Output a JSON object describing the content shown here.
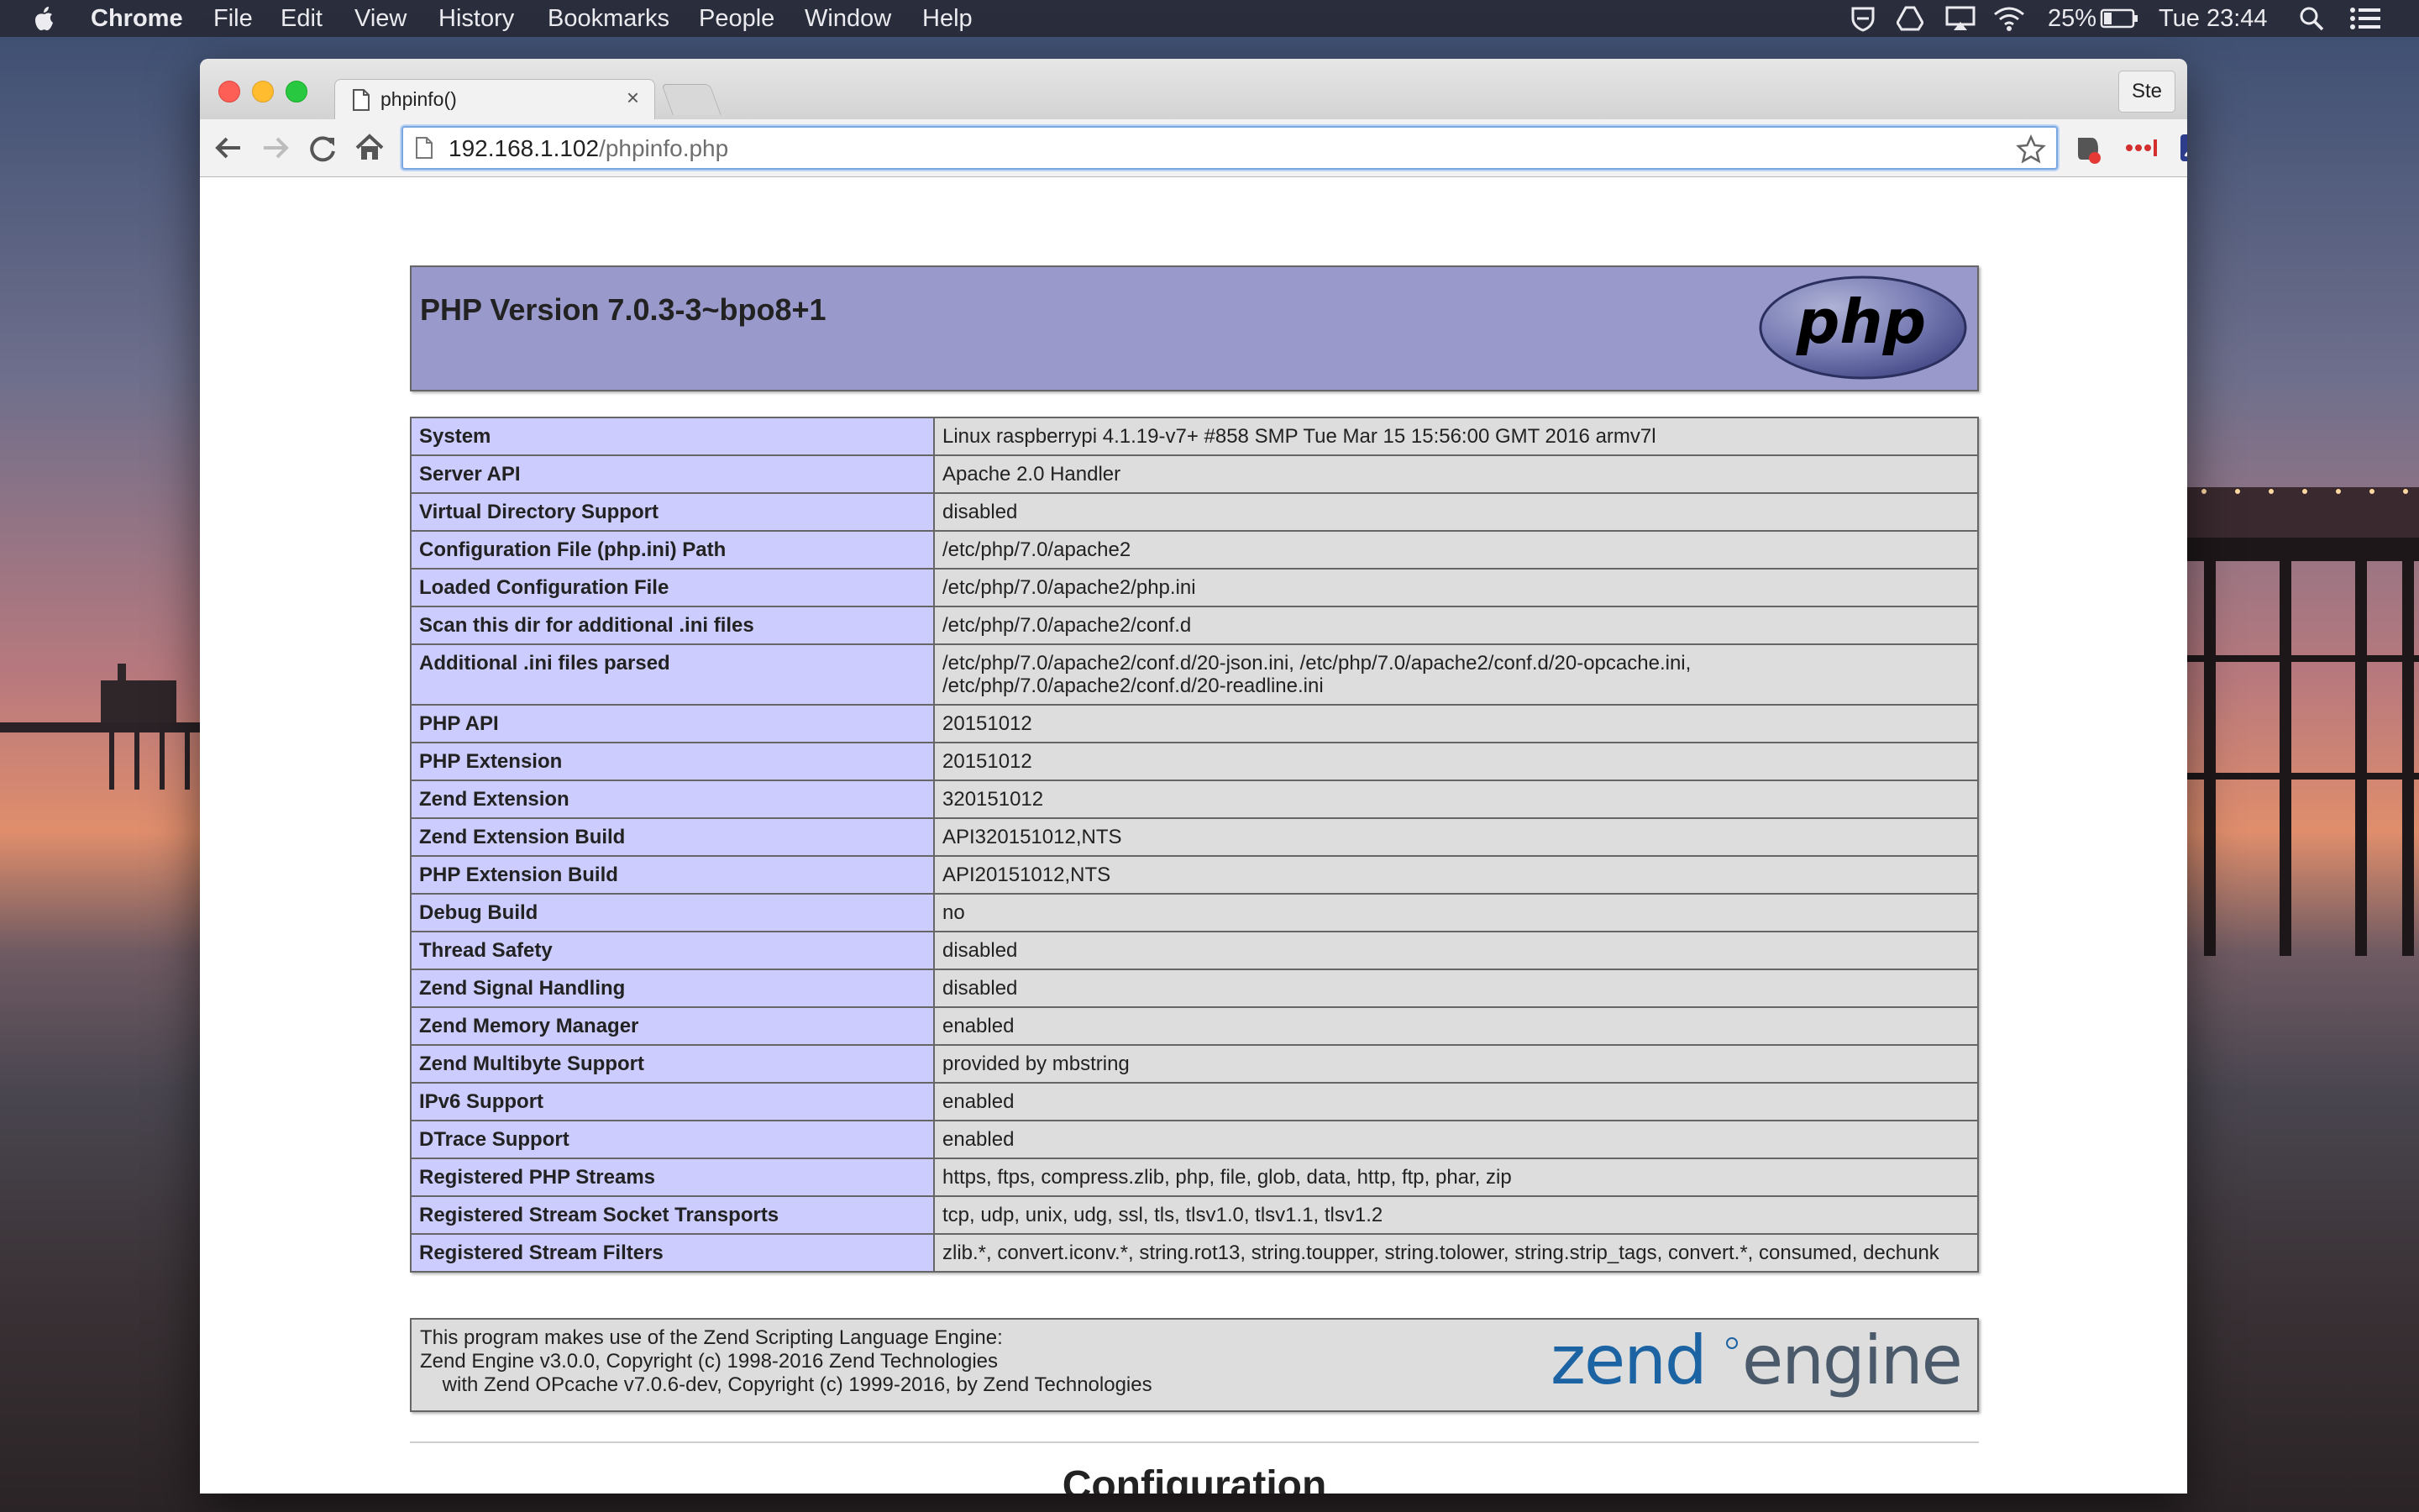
{
  "menubar": {
    "app": "Chrome",
    "items": [
      "File",
      "Edit",
      "View",
      "History",
      "Bookmarks",
      "People",
      "Window",
      "Help"
    ],
    "battery": "25%",
    "clock": "Tue 23:44"
  },
  "browser": {
    "tab_title": "phpinfo()",
    "tab_close": "×",
    "profile": "Ste",
    "url_host": "192.168.1.102",
    "url_path": "/phpinfo.php"
  },
  "page": {
    "php_version": "PHP Version 7.0.3-3~bpo8+1",
    "php_logo_text": "php",
    "rows": [
      {
        "k": "System",
        "v": "Linux raspberrypi 4.1.19-v7+ #858 SMP Tue Mar 15 15:56:00 GMT 2016 armv7l"
      },
      {
        "k": "Server API",
        "v": "Apache 2.0 Handler"
      },
      {
        "k": "Virtual Directory Support",
        "v": "disabled"
      },
      {
        "k": "Configuration File (php.ini) Path",
        "v": "/etc/php/7.0/apache2"
      },
      {
        "k": "Loaded Configuration File",
        "v": "/etc/php/7.0/apache2/php.ini"
      },
      {
        "k": "Scan this dir for additional .ini files",
        "v": "/etc/php/7.0/apache2/conf.d"
      },
      {
        "k": "Additional .ini files parsed",
        "v": "/etc/php/7.0/apache2/conf.d/20-json.ini, /etc/php/7.0/apache2/conf.d/20-opcache.ini,",
        "v2": "/etc/php/7.0/apache2/conf.d/20-readline.ini"
      },
      {
        "k": "PHP API",
        "v": "20151012"
      },
      {
        "k": "PHP Extension",
        "v": "20151012"
      },
      {
        "k": "Zend Extension",
        "v": "320151012"
      },
      {
        "k": "Zend Extension Build",
        "v": "API320151012,NTS"
      },
      {
        "k": "PHP Extension Build",
        "v": "API20151012,NTS"
      },
      {
        "k": "Debug Build",
        "v": "no"
      },
      {
        "k": "Thread Safety",
        "v": "disabled"
      },
      {
        "k": "Zend Signal Handling",
        "v": "disabled"
      },
      {
        "k": "Zend Memory Manager",
        "v": "enabled"
      },
      {
        "k": "Zend Multibyte Support",
        "v": "provided by mbstring"
      },
      {
        "k": "IPv6 Support",
        "v": "enabled"
      },
      {
        "k": "DTrace Support",
        "v": "enabled"
      },
      {
        "k": "Registered PHP Streams",
        "v": "https, ftps, compress.zlib, php, file, glob, data, http, ftp, phar, zip"
      },
      {
        "k": "Registered Stream Socket Transports",
        "v": "tcp, udp, unix, udg, ssl, tls, tlsv1.0, tlsv1.1, tlsv1.2"
      },
      {
        "k": "Registered Stream Filters",
        "v": "zlib.*, convert.iconv.*, string.rot13, string.toupper, string.tolower, string.strip_tags, convert.*, consumed, dechunk"
      }
    ],
    "zend_lines": [
      "This program makes use of the Zend Scripting Language Engine:",
      "Zend Engine v3.0.0, Copyright (c) 1998-2016 Zend Technologies",
      "    with Zend OPcache v7.0.6-dev, Copyright (c) 1999-2016, by Zend Technologies"
    ],
    "zend_logo_word1": "zend",
    "zend_logo_word2": "engine",
    "config_heading": "Configuration"
  }
}
